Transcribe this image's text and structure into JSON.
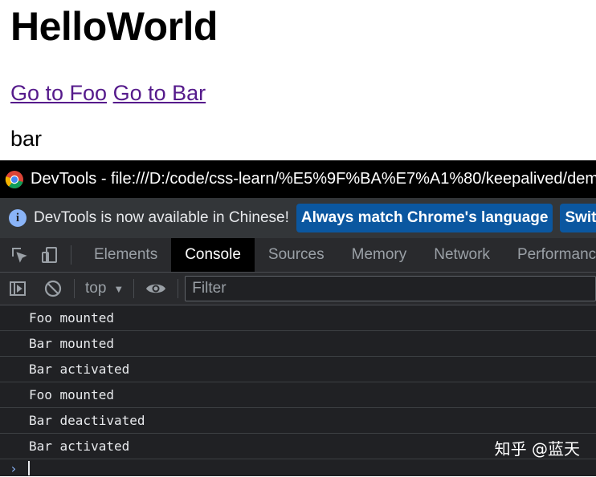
{
  "page": {
    "heading": "HelloWorld",
    "link_foo": "Go to Foo",
    "link_bar": "Go to Bar",
    "content": "bar"
  },
  "devtools": {
    "title": "DevTools - file:///D:/code/css-learn/%E5%9F%BA%E7%A1%80/keepalived/dem",
    "info": {
      "icon": "info-icon",
      "message": "DevTools is now available in Chinese!",
      "button_match": "Always match Chrome's language",
      "button_switch": "Switch De"
    },
    "tabs": [
      "Elements",
      "Console",
      "Sources",
      "Memory",
      "Network",
      "Performanc"
    ],
    "active_tab": "Console",
    "toolbar": {
      "context": "top",
      "filter_placeholder": "Filter"
    },
    "console_logs": [
      "Foo mounted",
      "Bar mounted",
      "Bar activated",
      "Foo mounted",
      "Bar deactivated",
      "Bar activated"
    ],
    "prompt_symbol": "›"
  },
  "watermark": "知乎 @蓝天"
}
